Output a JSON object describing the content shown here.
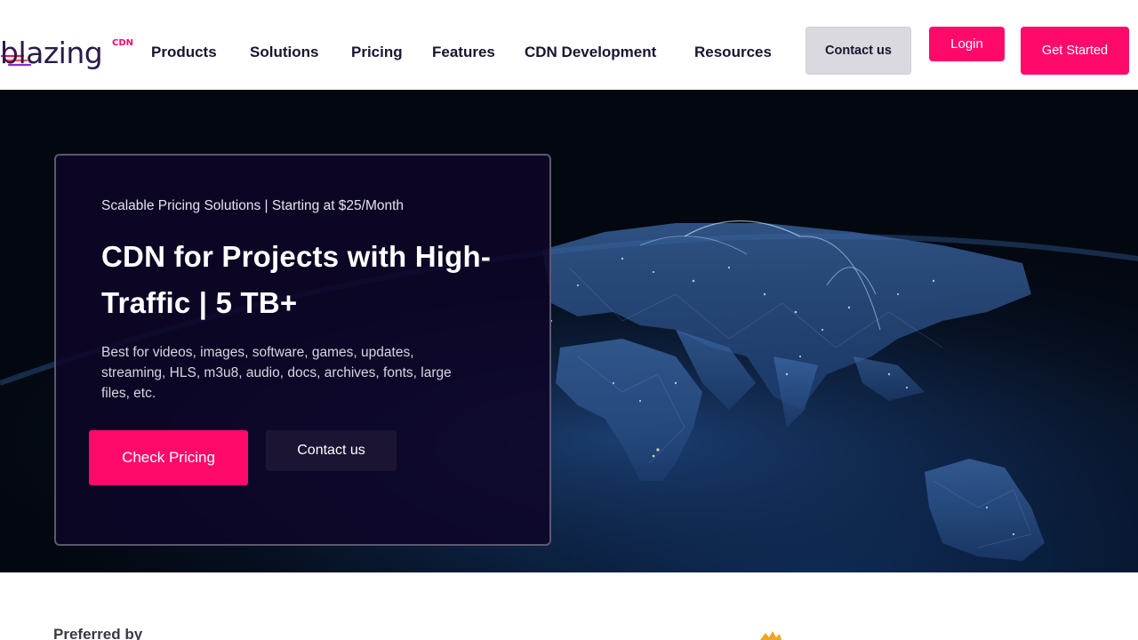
{
  "header": {
    "logo": {
      "wordmark": "blazing",
      "badge": "CDN"
    },
    "nav": [
      {
        "label": "Products"
      },
      {
        "label": "Solutions"
      },
      {
        "label": "Pricing"
      },
      {
        "label": "Features"
      },
      {
        "label": "CDN Development"
      },
      {
        "label": "Resources"
      }
    ],
    "contact_label": "Contact us",
    "login_label": "Login",
    "get_started_label": "Get Started"
  },
  "hero": {
    "eyebrow": "Scalable Pricing Solutions | Starting at $25/Month",
    "title": "CDN for Projects with High-Traffic | 5 TB+",
    "description": "Best for videos, images, software, games, updates, streaming, HLS, m3u8, audio, docs, archives, fonts, large files, etc.",
    "primary_cta": "Check Pricing",
    "secondary_cta": "Contact us"
  },
  "trust": {
    "heading": "Preferred by"
  },
  "colors": {
    "accent": "#ff0a6b",
    "nav_text": "#161630",
    "card_bg": "#0e0628",
    "hero_bg": "#050c1a"
  },
  "icons": {
    "logo_mark": "speed-lines-icon",
    "globe": "network-globe-image"
  }
}
